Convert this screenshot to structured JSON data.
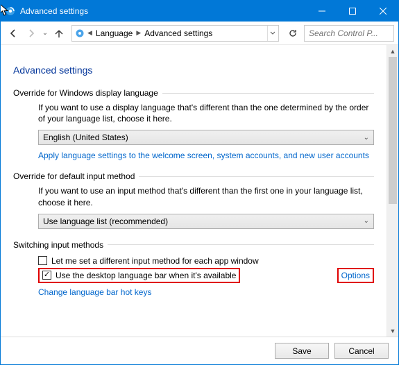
{
  "titlebar": {
    "title": "Advanced settings"
  },
  "breadcrumb": {
    "item1": "Language",
    "item2": "Advanced settings",
    "search_placeholder": "Search Control P..."
  },
  "page": {
    "title": "Advanced settings"
  },
  "sec1": {
    "header": "Override for Windows display language",
    "desc": "If you want to use a display language that's different than the one determined by the order of your language list, choose it here.",
    "combo": "English (United States)",
    "link": "Apply language settings to the welcome screen, system accounts, and new user accounts"
  },
  "sec2": {
    "header": "Override for default input method",
    "desc": "If you want to use an input method that's different than the first one in your language list, choose it here.",
    "combo": "Use language list (recommended)"
  },
  "sec3": {
    "header": "Switching input methods",
    "cb1": "Let me set a different input method for each app window",
    "cb2": "Use the desktop language bar when it's available",
    "options": "Options",
    "link": "Change language bar hot keys"
  },
  "footer": {
    "save": "Save",
    "cancel": "Cancel"
  }
}
